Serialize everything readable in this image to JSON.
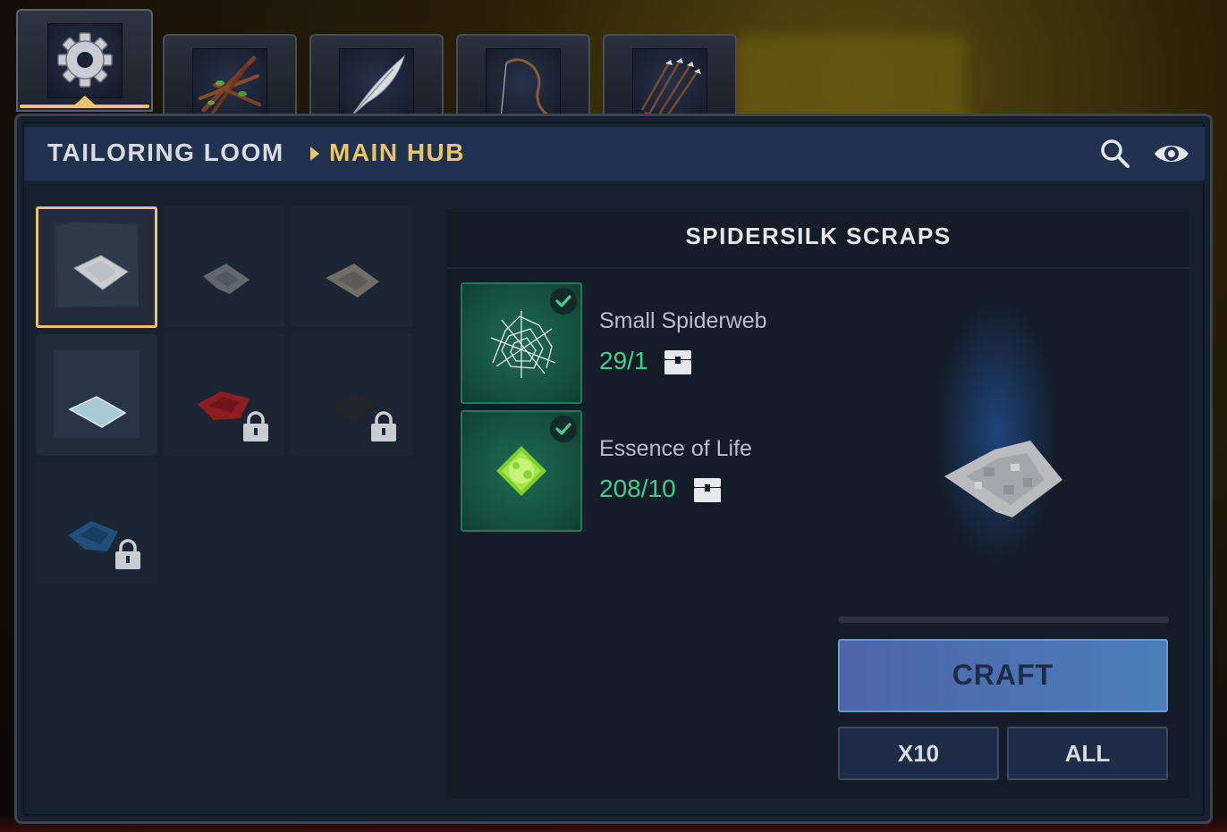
{
  "tabs": [
    {
      "icon": "gear-icon",
      "active": true
    },
    {
      "icon": "sticks-icon",
      "active": false
    },
    {
      "icon": "feather-icon",
      "active": false
    },
    {
      "icon": "bow-icon",
      "active": false
    },
    {
      "icon": "arrows-icon",
      "active": false
    }
  ],
  "header": {
    "crumb_station": "TAILORING LOOM",
    "crumb_current": "MAIN HUB",
    "icons": [
      "search-icon",
      "eye-icon"
    ]
  },
  "recipes": [
    {
      "item": "silk-scrap-white",
      "selected": true,
      "locked": false
    },
    {
      "item": "silk-scrap-gray",
      "selected": false,
      "locked": false
    },
    {
      "item": "silk-scrap-stone",
      "selected": false,
      "locked": false
    },
    {
      "item": "silk-scrap-pale-blue",
      "selected": false,
      "locked": false
    },
    {
      "item": "cloth-red",
      "selected": false,
      "locked": true
    },
    {
      "item": "cloth-black",
      "selected": false,
      "locked": true
    },
    {
      "item": "cloth-blue",
      "selected": false,
      "locked": true
    }
  ],
  "detail": {
    "title": "SPIDERSILK SCRAPS",
    "ingredients": [
      {
        "name": "Small Spiderweb",
        "count": "29/1",
        "icon": "spiderweb-icon",
        "satisfied": true
      },
      {
        "name": "Essence of Life",
        "count": "208/10",
        "icon": "essence-icon",
        "satisfied": true
      }
    ],
    "progress": 0,
    "craft_label": "CRAFT",
    "x10_label": "X10",
    "all_label": "ALL"
  },
  "colors": {
    "accent": "#e9c46a",
    "ok": "#3fd18a",
    "panel": "#182130",
    "header": "#20324f"
  }
}
